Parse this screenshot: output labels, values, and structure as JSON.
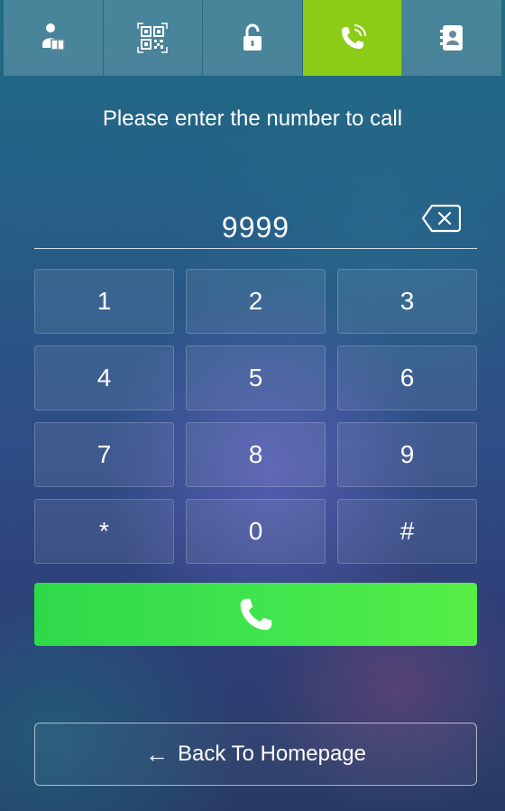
{
  "tabs": [
    {
      "icon": "delivery-person-icon",
      "active": false
    },
    {
      "icon": "qr-code-icon",
      "active": false
    },
    {
      "icon": "unlock-icon",
      "active": false
    },
    {
      "icon": "phone-ringing-icon",
      "active": true
    },
    {
      "icon": "contacts-icon",
      "active": false
    }
  ],
  "prompt": "Please enter the number to call",
  "dialed_number": "9999",
  "keypad": {
    "keys": [
      "1",
      "2",
      "3",
      "4",
      "5",
      "6",
      "7",
      "8",
      "9",
      "*",
      "0",
      "#"
    ]
  },
  "call_button": {
    "icon": "phone-icon"
  },
  "back_button": {
    "arrow": "←",
    "label": "Back To Homepage"
  },
  "colors": {
    "active_tab": "#8ccc16",
    "call_green": "#43e64d",
    "text": "#ffffff"
  }
}
